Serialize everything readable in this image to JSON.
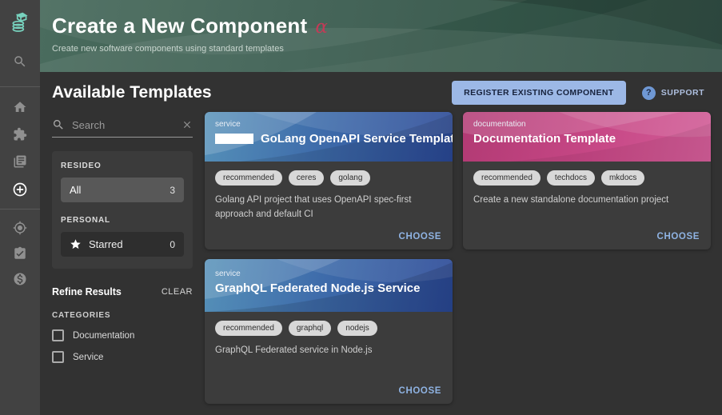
{
  "hero": {
    "title": "Create a New Component",
    "badge": "α",
    "subtitle": "Create new software components using standard templates"
  },
  "toolbar": {
    "heading": "Available Templates",
    "register_button": "REGISTER EXISTING COMPONENT",
    "support_label": "SUPPORT",
    "help_glyph": "?"
  },
  "rail": {
    "icons": [
      "backstage-logo",
      "search",
      "home",
      "extensions",
      "docs",
      "create",
      "tech-radar",
      "tasks",
      "cost-insights"
    ]
  },
  "filters": {
    "search_placeholder": "Search",
    "groups": [
      {
        "label": "RESIDEO",
        "items": [
          {
            "label": "All",
            "count": "3",
            "selected": true
          }
        ]
      },
      {
        "label": "PERSONAL",
        "items": [
          {
            "label": "Starred",
            "count": "0",
            "selected": false
          }
        ]
      }
    ],
    "refine_title": "Refine Results",
    "clear_label": "CLEAR",
    "categories_label": "CATEGORIES",
    "categories": [
      {
        "label": "Documentation",
        "checked": false
      },
      {
        "label": "Service",
        "checked": false
      }
    ]
  },
  "cards": [
    {
      "type": "service",
      "title": "GoLang OpenAPI Service Template",
      "tags": [
        "recommended",
        "ceres",
        "golang"
      ],
      "description": "Golang API project that uses OpenAPI spec-first approach and default CI",
      "action": "CHOOSE",
      "theme": "blue"
    },
    {
      "type": "documentation",
      "title": "Documentation Template",
      "tags": [
        "recommended",
        "techdocs",
        "mkdocs"
      ],
      "description": "Create a new standalone documentation project",
      "action": "CHOOSE",
      "theme": "pink"
    },
    {
      "type": "service",
      "title": "GraphQL Federated Node.js Service",
      "tags": [
        "recommended",
        "graphql",
        "nodejs"
      ],
      "description": "GraphQL Federated service in Node.js",
      "action": "CHOOSE",
      "theme": "blue"
    }
  ],
  "colors": {
    "hero_green": "#3c5e51",
    "alpha_badge": "#c23b57",
    "card_blue_start": "#5590b8",
    "card_blue_end": "#2a4896",
    "card_pink_start": "#b23a74",
    "card_pink_end": "#d25d97",
    "register_button_bg": "#9cb8e6",
    "choose_link": "#8fb3e3",
    "tag_bg": "#d8d8d8",
    "logo_teal": "#77d1bd"
  }
}
